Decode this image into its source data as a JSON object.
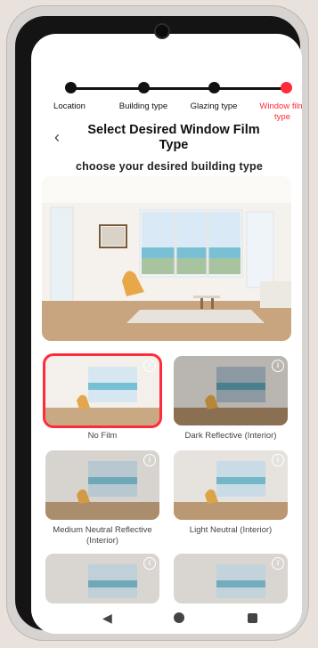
{
  "stepper": {
    "steps": [
      {
        "label": "Location",
        "state": "done"
      },
      {
        "label": "Building type",
        "state": "done"
      },
      {
        "label": "Glazing type",
        "state": "done"
      },
      {
        "label": "Window film type",
        "state": "current"
      }
    ]
  },
  "header": {
    "title": "Select Desired Window Film Type",
    "subtitle": "choose your desired building type"
  },
  "options": [
    {
      "label": "No Film",
      "selected": true
    },
    {
      "label": "Dark Reflective (Interior)",
      "selected": false
    },
    {
      "label": "Medium Neutral Reflective (Interior)",
      "selected": false
    },
    {
      "label": "Light Neutral (Interior)",
      "selected": false
    },
    {
      "label": "",
      "selected": false
    },
    {
      "label": "",
      "selected": false
    }
  ],
  "icons": {
    "back": "chevron-left-icon",
    "info": "info-icon",
    "nav_back": "triangle-back-icon",
    "nav_home": "circle-home-icon",
    "nav_recent": "square-recent-icon"
  },
  "colors": {
    "accent": "#ff2a3a",
    "text": "#111111"
  }
}
